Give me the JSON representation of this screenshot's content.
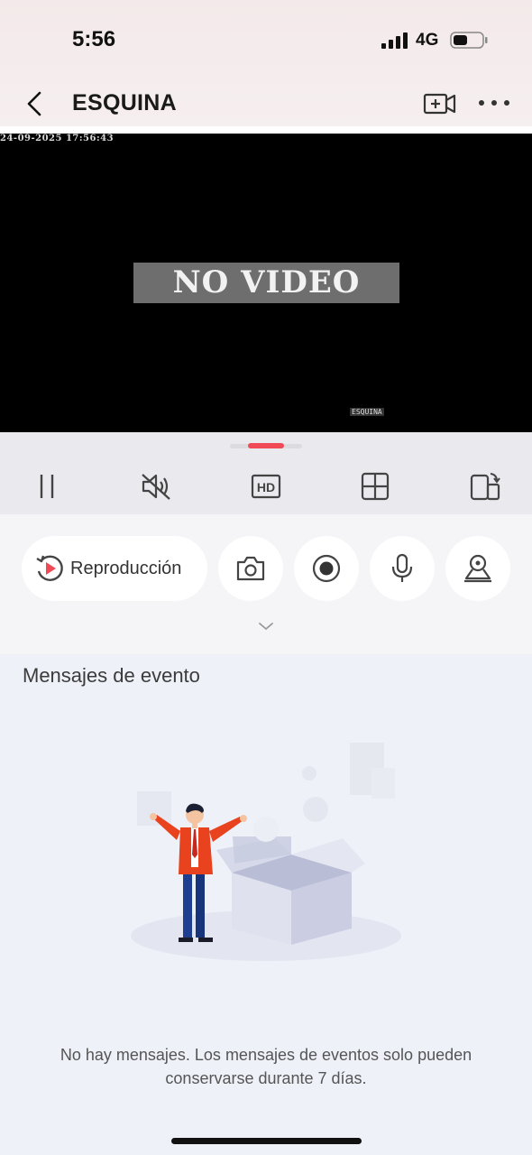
{
  "status": {
    "time": "5:56",
    "network": "4G"
  },
  "nav": {
    "title": "ESQUINA"
  },
  "video": {
    "osd_timestamp": "24-09-2025 17:56:43",
    "overlay_text": "NO VIDEO",
    "osd_camera_name": "ESQUINA"
  },
  "controls": {
    "icons": [
      "pause-icon",
      "mute-icon",
      "hd-icon",
      "grid-icon",
      "rotate-screen-icon"
    ],
    "hd_label": "HD"
  },
  "actions": {
    "playback_label": "Reproducción",
    "buttons": [
      "snapshot-icon",
      "record-icon",
      "microphone-icon",
      "ptz-icon"
    ]
  },
  "events": {
    "title": "Mensajes de evento",
    "empty_message": "No hay mensajes. Los mensajes de eventos solo pueden conservarse durante 7 días."
  },
  "colors": {
    "accent": "#ef4a55",
    "text": "#333333",
    "strip_bg": "#e9e9ee",
    "events_bg": "#eef1f8"
  }
}
